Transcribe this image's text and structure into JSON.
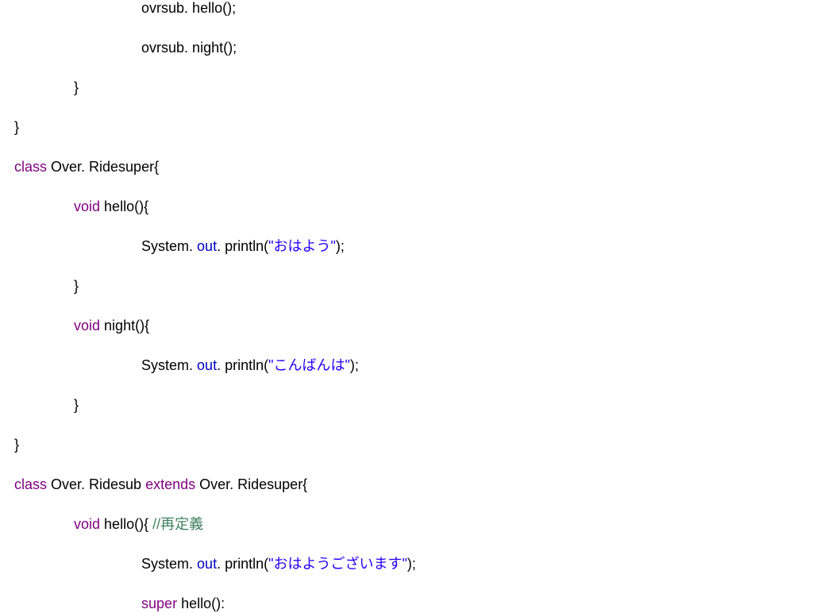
{
  "indent1": "               ",
  "indent2": "                                ",
  "lines": {
    "l1_code": "ovrsub. hello();",
    "l2_code": "ovrsub. night();",
    "l3_code": "}",
    "l4_code": "}",
    "l5_kw": "class",
    "l5_rest": " Over. Ridesuper{",
    "l6_kw": "void",
    "l6_rest": " hello(){",
    "l7_a": "System. ",
    "l7_field": "out",
    "l7_b": ". println(",
    "l7_str": "\"おはよう\"",
    "l7_c": ");",
    "l8_code": "}",
    "l9_kw": "void",
    "l9_rest": " night(){",
    "l10_a": "System. ",
    "l10_field": "out",
    "l10_b": ". println(",
    "l10_str": "\"こんばんは\"",
    "l10_c": ");",
    "l11_code": "}",
    "l12_code": "}",
    "l13_kw1": "class",
    "l13_mid": " Over. Ridesub ",
    "l13_kw2": "extends",
    "l13_rest": " Over. Ridesuper{",
    "l14_kw": "void",
    "l14_rest": " hello(){ ",
    "l14_cmt": "//再定義",
    "l15_a": "System. ",
    "l15_field": "out",
    "l15_b": ". println(",
    "l15_str": "\"おはようございます\"",
    "l15_c": ");",
    "l16_kw": "super",
    "l16_rest": " hello():"
  }
}
